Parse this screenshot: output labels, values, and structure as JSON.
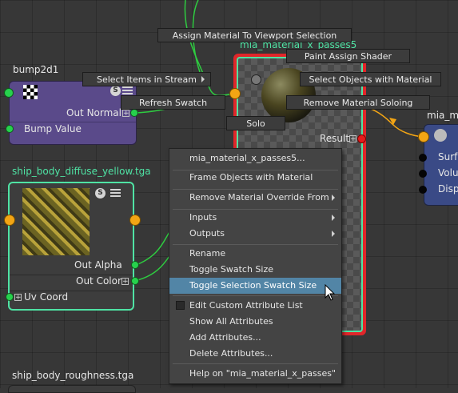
{
  "nodes": {
    "bump": {
      "title": "bump2d1",
      "out_normal": "Out Normal",
      "bump_value": "Bump Value"
    },
    "diffuse": {
      "title": "ship_body_diffuse_yellow.tga",
      "out_alpha": "Out Alpha",
      "out_color": "Out Color",
      "uv_coord": "Uv Coord"
    },
    "roughness": {
      "title": "ship_body_roughness.tga"
    },
    "material": {
      "title": "mia_material_x_passes5",
      "result": "Result"
    },
    "right_node": {
      "title": "mia_m",
      "attrs": [
        "Surfa",
        "Volu",
        "Disp"
      ]
    }
  },
  "hotbox": {
    "assign_material": "Assign Material To Viewport Selection",
    "paint_assign": "Paint Assign Shader",
    "select_items": "Select Items in Stream",
    "select_objects": "Select Objects with Material",
    "refresh_swatch": "Refresh Swatch",
    "remove_soloing": "Remove Material Soloing",
    "solo": "Solo"
  },
  "context_menu": {
    "header": "mia_material_x_passes5...",
    "items": [
      "Frame Objects with Material",
      "Remove Material Override From",
      "Inputs",
      "Outputs",
      "Rename",
      "Toggle Swatch Size",
      "Toggle Selection Swatch Size",
      "Edit Custom Attribute List",
      "Show All Attributes",
      "Add Attributes...",
      "Delete Attributes...",
      "Help on \"mia_material_x_passes\""
    ]
  },
  "icons": {
    "swatch": "swatch-icon",
    "attr_list": "attribute-list-icon",
    "plus": "+"
  },
  "colors": {
    "background": "#373737",
    "bump_node": "#5a4a8a",
    "texture_node": "#3d3d3d",
    "selected_outline": "#4fe3a4",
    "material_outline": "#e0262a",
    "menu_highlight": "#5285a6",
    "port_green": "#27d14d",
    "port_orange": "#f3a514"
  }
}
